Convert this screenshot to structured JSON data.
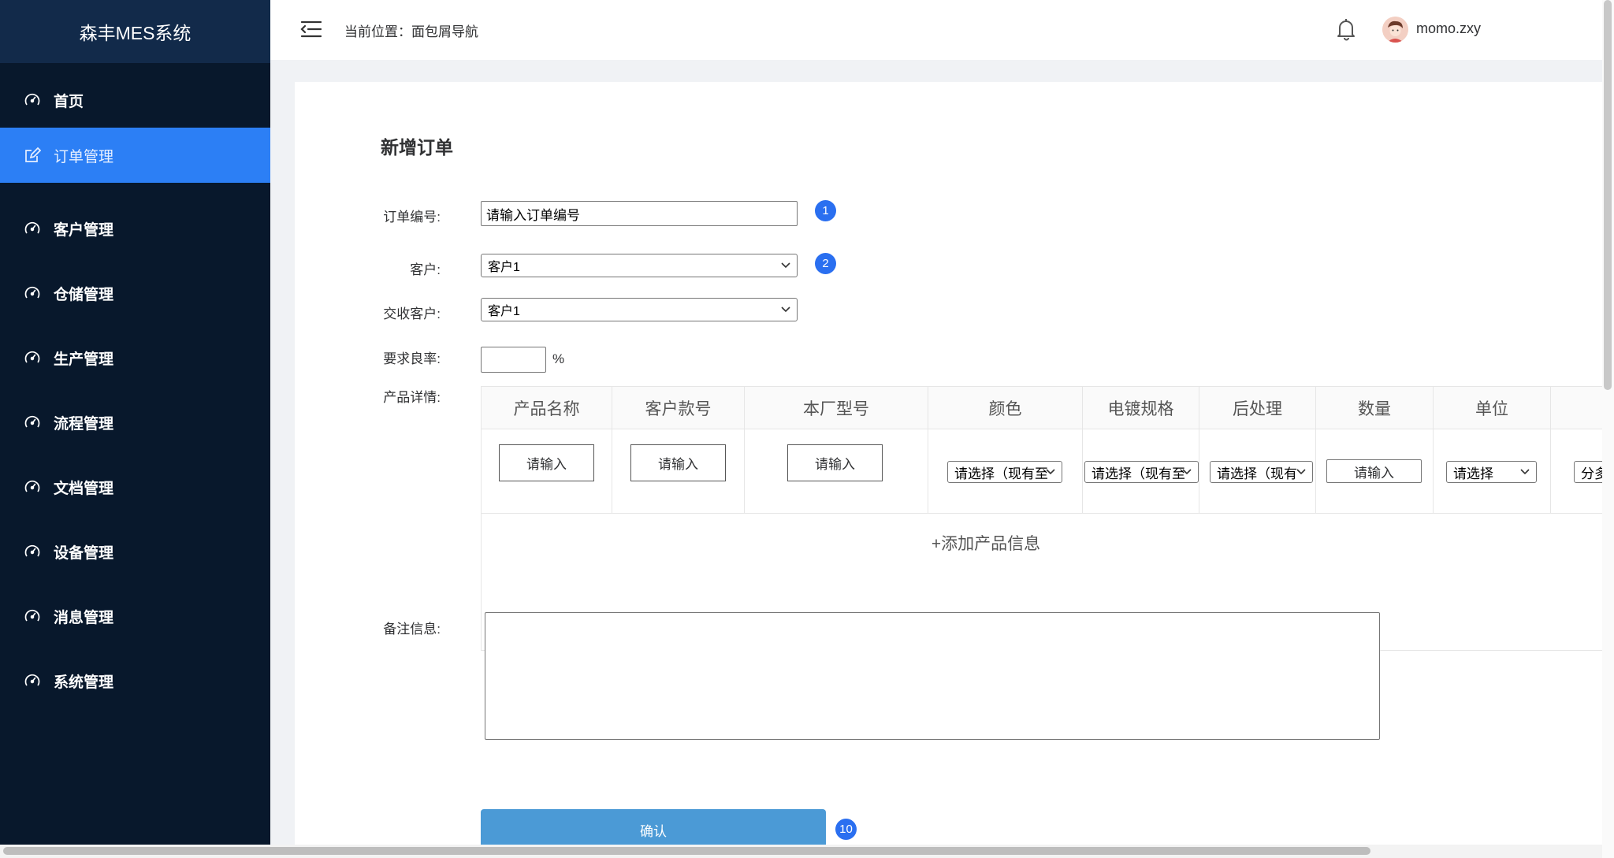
{
  "app": {
    "title": "森丰MES系统"
  },
  "sidebar": {
    "items": [
      {
        "label": "首页",
        "icon": "dashboard-icon",
        "active": false
      },
      {
        "label": "订单管理",
        "icon": "edit-icon",
        "active": true
      },
      {
        "label": "客户管理",
        "icon": "dashboard-icon",
        "active": false
      },
      {
        "label": "仓储管理",
        "icon": "dashboard-icon",
        "active": false
      },
      {
        "label": "生产管理",
        "icon": "dashboard-icon",
        "active": false
      },
      {
        "label": "流程管理",
        "icon": "dashboard-icon",
        "active": false
      },
      {
        "label": "文档管理",
        "icon": "dashboard-icon",
        "active": false
      },
      {
        "label": "设备管理",
        "icon": "dashboard-icon",
        "active": false
      },
      {
        "label": "消息管理",
        "icon": "dashboard-icon",
        "active": false
      },
      {
        "label": "系统管理",
        "icon": "dashboard-icon",
        "active": false
      }
    ]
  },
  "header": {
    "breadcrumb": "当前位置：面包屑导航",
    "username": "momo.zxy"
  },
  "form": {
    "title": "新增订单",
    "order_no_label": "订单编号:",
    "order_no_placeholder": "请输入订单编号",
    "customer_label": "客户:",
    "customer_value": "客户1",
    "delivery_customer_label": "交收客户:",
    "delivery_customer_value": "客户1",
    "yield_label": "要求良率:",
    "yield_value": "",
    "yield_unit": "%",
    "product_label": "产品详情:",
    "remark_label": "备注信息:",
    "confirm_label": "确认"
  },
  "badges": {
    "b1": "1",
    "b2": "2",
    "b10": "10"
  },
  "product_table": {
    "headers": [
      "产品名称",
      "客户款号",
      "本厂型号",
      "颜色",
      "电镀规格",
      "后处理",
      "数量",
      "单位"
    ],
    "row": {
      "name_btn": "请输入",
      "style_btn": "请输入",
      "model_btn": "请输入",
      "color_select": "请选择（现有至",
      "plating_select": "请选择（现有至",
      "post_select": "请选择（现有",
      "qty_input": "请输入",
      "unit_select": "请选择",
      "extra_select": "分多"
    },
    "add_row_label": "+添加产品信息"
  }
}
